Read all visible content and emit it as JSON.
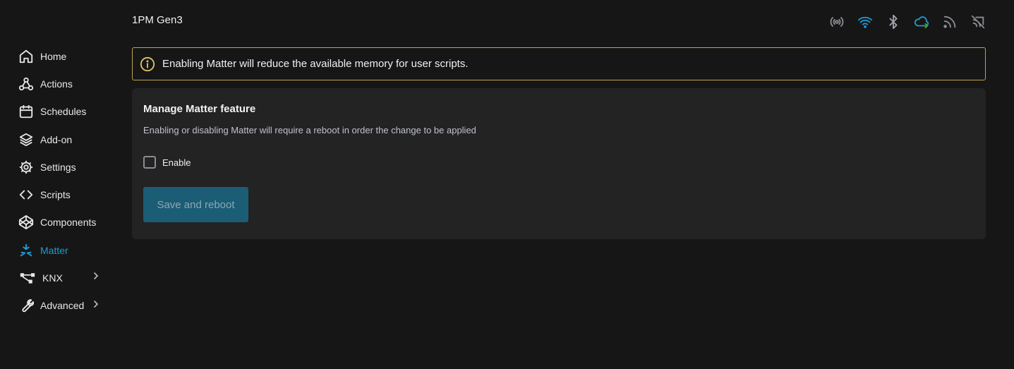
{
  "header": {
    "device_name": "1PM Gen3",
    "status_icons": [
      {
        "name": "ap-broadcast-icon",
        "color": "#8a8d94"
      },
      {
        "name": "wifi-icon",
        "color": "#1d9bd1"
      },
      {
        "name": "bluetooth-icon",
        "color": "#a0a3a9"
      },
      {
        "name": "cloud-sync-icon",
        "color": "#1d9bd1"
      },
      {
        "name": "rss-icon",
        "color": "#8a8d94"
      },
      {
        "name": "mqtt-off-icon",
        "color": "#8a8d94"
      }
    ]
  },
  "sidebar": {
    "items": [
      {
        "label": "Home",
        "icon": "home-icon"
      },
      {
        "label": "Actions",
        "icon": "webhook-icon"
      },
      {
        "label": "Schedules",
        "icon": "calendar-icon"
      },
      {
        "label": "Add-on",
        "icon": "layers-icon"
      },
      {
        "label": "Settings",
        "icon": "gear-icon"
      },
      {
        "label": "Scripts",
        "icon": "code-icon"
      },
      {
        "label": "Components",
        "icon": "codepen-icon"
      },
      {
        "label": "Matter",
        "icon": "matter-icon",
        "active": true
      },
      {
        "label": "KNX",
        "icon": "knx-icon",
        "expandable": true
      },
      {
        "label": "Advanced",
        "icon": "wrench-icon",
        "expandable": true
      }
    ],
    "active_color": "#1d9bd1"
  },
  "notice": {
    "text": "Enabling Matter will reduce the available memory for user scripts.",
    "border_color": "#bfa54c"
  },
  "card": {
    "title": "Manage Matter feature",
    "description": "Enabling or disabling Matter will require a reboot in order the change to be applied",
    "checkbox_label": "Enable",
    "checkbox_checked": false,
    "save_label": "Save and reboot",
    "save_disabled": true
  }
}
